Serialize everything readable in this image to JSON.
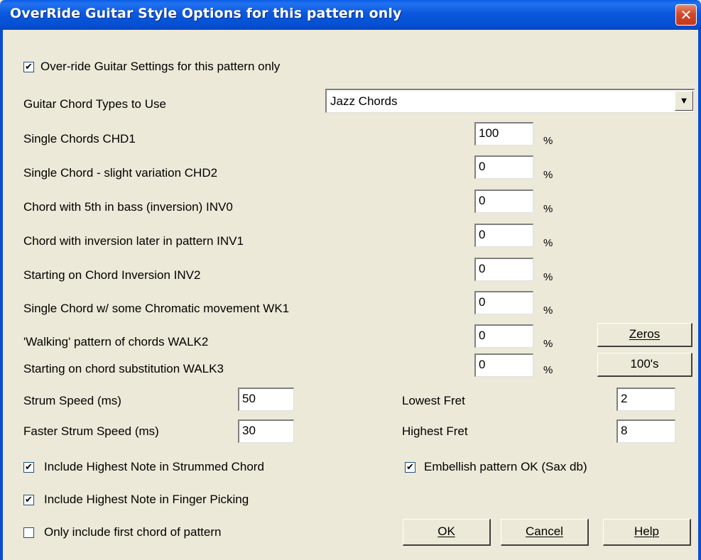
{
  "window": {
    "title": "OverRide Guitar Style Options for this pattern only",
    "close_glyph": "✕"
  },
  "override_checkbox": {
    "checked": true,
    "label": "Over-ride Guitar Settings for this pattern only"
  },
  "chord_types": {
    "label": "Guitar Chord Types to Use",
    "value": "Jazz Chords",
    "arrow": "▼"
  },
  "percent_symbol": "%",
  "rows": [
    {
      "label": "Single Chords  CHD1",
      "value": "100"
    },
    {
      "label": "Single Chord - slight variation   CHD2",
      "value": "0"
    },
    {
      "label": "Chord with 5th in bass (inversion)  INV0",
      "value": "0"
    },
    {
      "label": "Chord with inversion later in pattern  INV1",
      "value": "0"
    },
    {
      "label": "Starting on Chord Inversion  INV2",
      "value": "0"
    },
    {
      "label": "Single Chord w/ some Chromatic movement  WK1",
      "value": "0"
    },
    {
      "label": "'Walking' pattern of chords  WALK2",
      "value": "0"
    },
    {
      "label": "Starting on chord substitution  WALK3",
      "value": "0"
    }
  ],
  "buttons": {
    "zeros": "Zeros",
    "hundreds": "100's",
    "ok": "OK",
    "cancel": "Cancel",
    "help": "Help"
  },
  "strum_speed": {
    "label": "Strum Speed (ms)",
    "value": "50"
  },
  "faster_strum_speed": {
    "label": "Faster Strum Speed (ms)",
    "value": "30"
  },
  "lowest_fret": {
    "label": "Lowest Fret",
    "value": "2"
  },
  "highest_fret": {
    "label": "Highest Fret",
    "value": "8"
  },
  "checkboxes": {
    "include_highest_strummed": {
      "checked": true,
      "label": "Include Highest Note in Strummed Chord"
    },
    "include_highest_finger": {
      "checked": true,
      "label": "Include Highest Note in Finger Picking"
    },
    "only_first_chord": {
      "checked": false,
      "label": "Only include first chord of pattern"
    },
    "embellish": {
      "checked": true,
      "label": "Embellish pattern OK (Sax db)"
    }
  },
  "check_glyph": "✔",
  "colors": {
    "titlebar": "#0b58de",
    "dialog_bg": "#ece9d8",
    "close_button": "#d1492a"
  }
}
